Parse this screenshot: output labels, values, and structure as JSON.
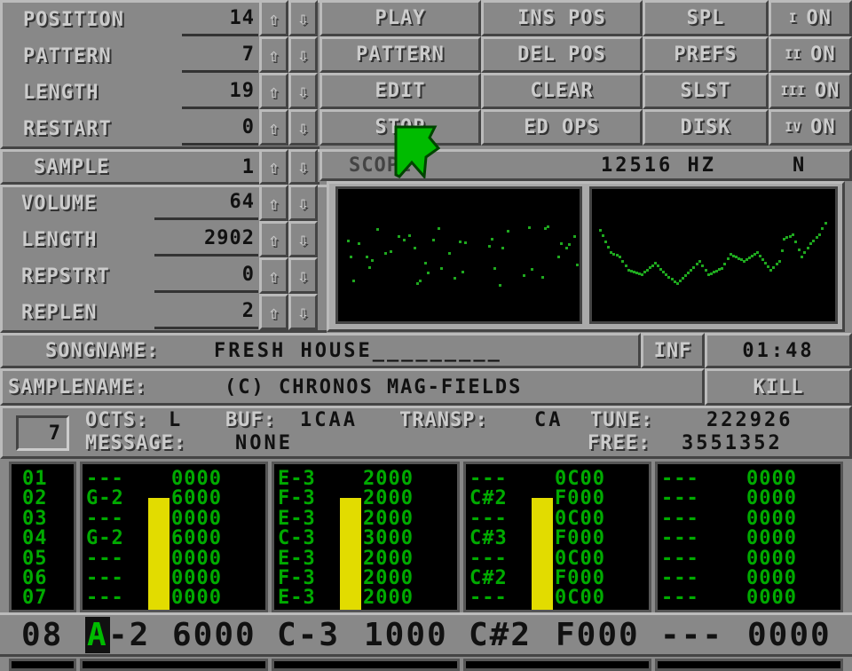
{
  "song_controls": [
    {
      "label": "POSITION",
      "value": "14"
    },
    {
      "label": "PATTERN",
      "value": "7"
    },
    {
      "label": "LENGTH",
      "value": "19"
    },
    {
      "label": "RESTART",
      "value": "0"
    }
  ],
  "arrows": {
    "up": "⇧",
    "down": "⇩"
  },
  "main_buttons": [
    [
      "PLAY",
      "INS POS",
      "SPL"
    ],
    [
      "PATTERN",
      "DEL POS",
      "PREFS"
    ],
    [
      "EDIT",
      "CLEAR",
      "SLST"
    ],
    [
      "STOP",
      "ED OPS",
      "DISK"
    ]
  ],
  "channel_toggles": [
    {
      "channel": "I",
      "state": "ON"
    },
    {
      "channel": "II",
      "state": "ON"
    },
    {
      "channel": "III",
      "state": "ON"
    },
    {
      "channel": "IV",
      "state": "ON"
    }
  ],
  "sample": {
    "label": "SAMPLE",
    "value": "1"
  },
  "sample_controls": [
    {
      "label": "VOLUME",
      "value": "64"
    },
    {
      "label": "LENGTH",
      "value": "2902"
    },
    {
      "label": "REPSTRT",
      "value": "0"
    },
    {
      "label": "REPLEN",
      "value": "2"
    }
  ],
  "scope_bar": {
    "label": "SCOPE",
    "freq": "12516 HZ",
    "mode": "N"
  },
  "songname": {
    "label": "SONGNAME:",
    "value": "FRESH HOUSE_________",
    "info_button": "INF",
    "time": "01:48"
  },
  "samplename": {
    "label": "SAMPLENAME:",
    "value": "(C) CHRONOS MAG-FIELDS",
    "kill_button": "KILL"
  },
  "status": {
    "edit_step": "7",
    "octs_label": "OCTS:",
    "octs_value": "L",
    "buf_label": "BUF:",
    "buf_value": "1CAA",
    "transp_label": "TRANSP:",
    "transp_value": "CA",
    "tune_label": "TUNE:",
    "tune_value": "222926",
    "message_label": "MESSAGE:",
    "message_value": "NONE",
    "free_label": "FREE:",
    "free_value": "3551352"
  },
  "pattern": {
    "row_numbers": [
      "01",
      "02",
      "03",
      "04",
      "05",
      "06",
      "07"
    ],
    "channels": [
      {
        "notes": [
          "---",
          "G-2",
          "---",
          "G-2",
          "---",
          "---",
          "---"
        ],
        "effects": [
          "0000",
          "6000",
          "0000",
          "6000",
          "0000",
          "0000",
          "0000"
        ],
        "vu_level": 0.78
      },
      {
        "notes": [
          "E-3",
          "F-3",
          "E-3",
          "C-3",
          "E-3",
          "F-3",
          "E-3"
        ],
        "effects": [
          "2000",
          "2000",
          "2000",
          "3000",
          "2000",
          "2000",
          "2000"
        ],
        "vu_level": 0.78
      },
      {
        "notes": [
          "---",
          "C#2",
          "---",
          "C#3",
          "---",
          "C#2",
          "---"
        ],
        "effects": [
          "0C00",
          "F000",
          "0C00",
          "F000",
          "0C00",
          "F000",
          "0C00"
        ],
        "vu_level": 0.78
      },
      {
        "notes": [
          "---",
          "---",
          "---",
          "---",
          "---",
          "---",
          "---"
        ],
        "effects": [
          "0000",
          "0000",
          "0000",
          "0000",
          "0000",
          "0000",
          "0000"
        ],
        "vu_level": 0
      }
    ],
    "current_row": {
      "number": "08",
      "cells": [
        {
          "note_first": "A",
          "note_rest": "-2",
          "effect": "6000"
        },
        {
          "note": "C-3",
          "effect": "1000"
        },
        {
          "note": "C#2",
          "effect": "F000"
        },
        {
          "note": "---",
          "effect": "0000"
        }
      ]
    }
  },
  "colors": {
    "pattern_text": "#00aa00",
    "vu_meter": "#e2dc00",
    "panel": "#888888",
    "cursor": "#00bb00"
  }
}
